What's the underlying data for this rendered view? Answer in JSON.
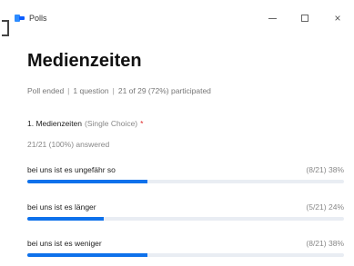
{
  "window": {
    "title": "Polls",
    "controls": {
      "minimize": "–",
      "maximize": "□",
      "close": "×"
    }
  },
  "poll": {
    "title": "Medienzeiten",
    "status": "Poll ended",
    "question_count": "1 question",
    "participation": "21 of 29 (72%) participated",
    "question": {
      "label": "1. Medienzeiten",
      "type": "(Single Choice)",
      "required": "*",
      "answered": "21/21 (100%) answered",
      "options": [
        {
          "label": "bei uns ist es ungefähr so",
          "count": "(8/21)",
          "percent": "38%",
          "fraction": 0.38
        },
        {
          "label": "bei uns ist es länger",
          "count": "(5/21)",
          "percent": "24%",
          "fraction": 0.24
        },
        {
          "label": "bei uns ist es weniger",
          "count": "(8/21)",
          "percent": "38%",
          "fraction": 0.38
        }
      ]
    }
  },
  "colors": {
    "accent": "#0e71eb",
    "track": "#e9edf3",
    "required": "#e02828"
  }
}
